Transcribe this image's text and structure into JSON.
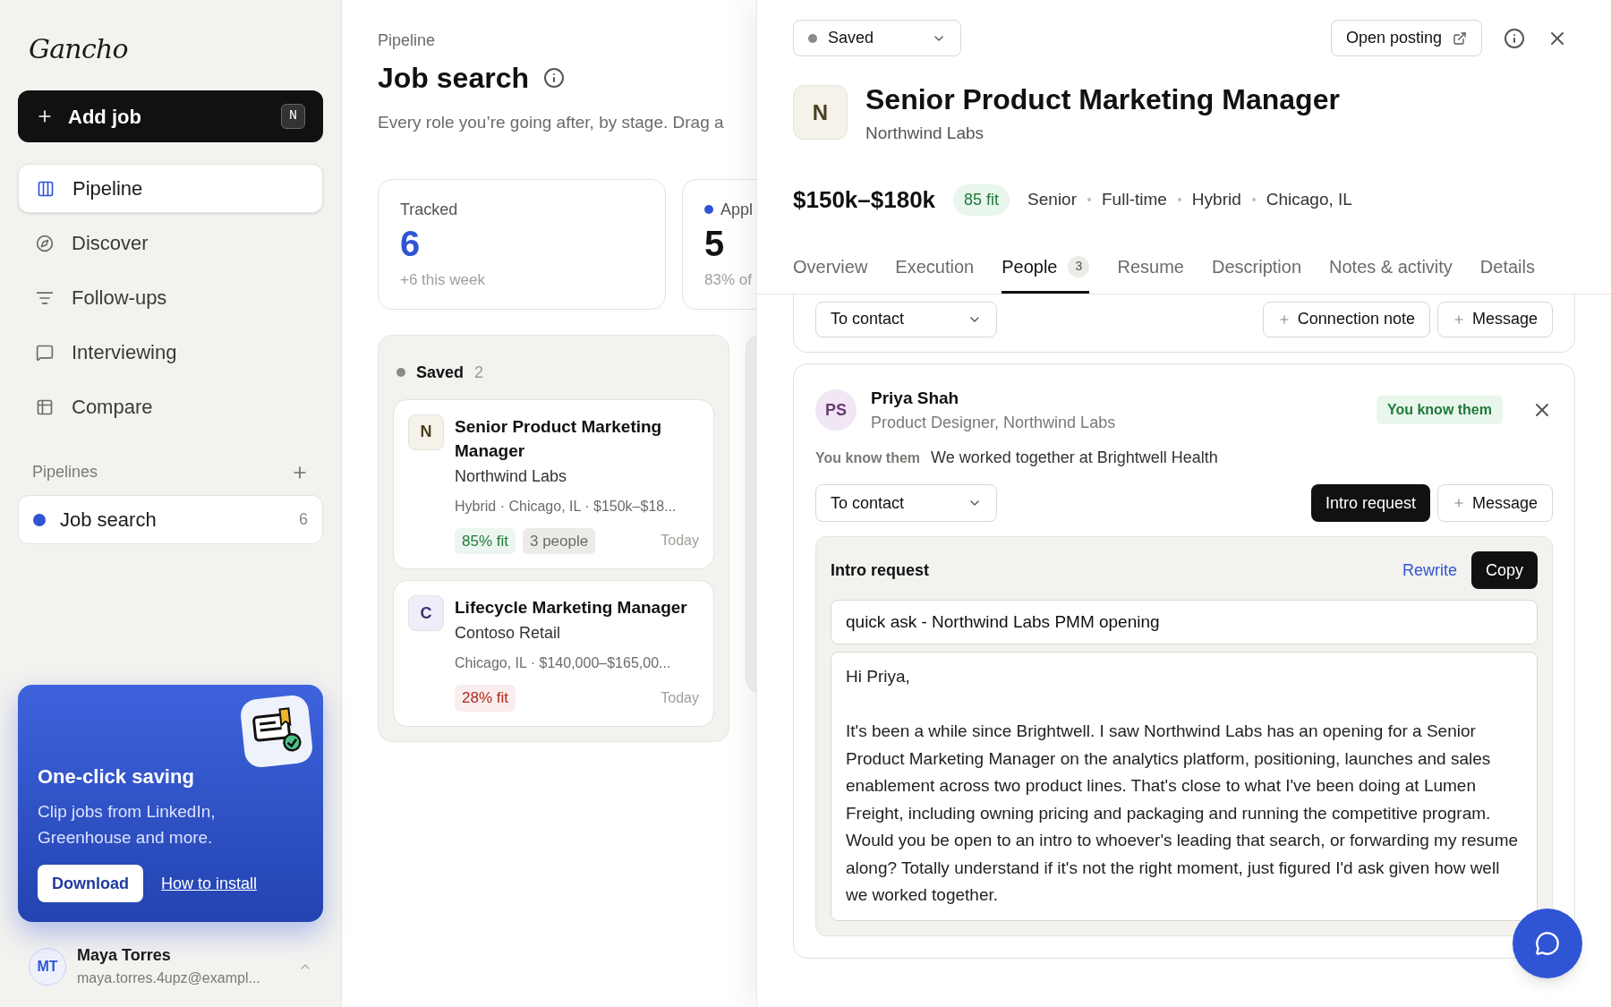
{
  "sidebar": {
    "logo": "Gancho",
    "add_job": {
      "label": "Add job",
      "shortcut": "N"
    },
    "nav": [
      {
        "label": "Pipeline",
        "selected": true
      },
      {
        "label": "Discover",
        "selected": false
      },
      {
        "label": "Follow-ups",
        "selected": false
      },
      {
        "label": "Interviewing",
        "selected": false
      },
      {
        "label": "Compare",
        "selected": false
      }
    ],
    "pipelines_label": "Pipelines",
    "pipelines": [
      {
        "label": "Job search",
        "count": "6",
        "color": "#2f55d4",
        "selected": true
      }
    ],
    "promo": {
      "title": "One-click saving",
      "text": "Clip jobs from LinkedIn, Greenhouse and more.",
      "button": "Download",
      "link": "How to install"
    },
    "user": {
      "initials": "MT",
      "name": "Maya Torres",
      "email": "maya.torres.4upz@exampl..."
    }
  },
  "main": {
    "breadcrumb": "Pipeline",
    "title": "Job search",
    "description": "Every role you’re going after, by stage. Drag a",
    "stats": [
      {
        "label": "Tracked",
        "value": "6",
        "note": "+6 this week",
        "highlight": true
      },
      {
        "label": "Appl",
        "value": "5",
        "note": "83% of",
        "highlight": false,
        "color": "#2f55d4"
      }
    ],
    "columns": [
      {
        "name": "Saved",
        "count": "2",
        "color": "#8a8a86",
        "cards": [
          {
            "initial": "N",
            "title": "Senior Product Marketing Manager",
            "company": "Northwind Labs",
            "meta": "Hybrid · Chicago, IL · $150k–$18...",
            "fit": "85% fit",
            "color": "#1f7a3a",
            "people": "3 people",
            "date": "Today"
          },
          {
            "initial": "C",
            "title": "Lifecycle Marketing Manager",
            "company": "Contoso Retail",
            "meta": "Chicago, IL · $140,000–$165,00...",
            "fit": "28% fit",
            "color": "#b3261e",
            "date": "Today"
          }
        ]
      }
    ]
  },
  "detail": {
    "status": "Saved",
    "open_posting": "Open posting",
    "initial": "N",
    "title": "Senior Product Marketing Manager",
    "company": "Northwind Labs",
    "salary": "$150k–$180k",
    "fit": "85 fit",
    "tags": [
      "Senior",
      "Full-time",
      "Hybrid",
      "Chicago, IL"
    ],
    "tabs": [
      {
        "label": "Overview",
        "selected": false
      },
      {
        "label": "Execution",
        "selected": false
      },
      {
        "label": "People",
        "count": "3",
        "selected": true
      },
      {
        "label": "Resume",
        "selected": false
      },
      {
        "label": "Description",
        "selected": false
      },
      {
        "label": "Notes & activity",
        "selected": false
      },
      {
        "label": "Details",
        "selected": false
      }
    ],
    "prev_card": {
      "status": "To contact",
      "actions": [
        "Connection note",
        "Message"
      ]
    },
    "contact": {
      "initials": "PS",
      "name": "Priya Shah",
      "role": "Product Designer, Northwind Labs",
      "badge": "You know them",
      "relation_label": "You know them",
      "relation": "We worked together at Brightwell Health",
      "status": "To contact",
      "primary_action": "Intro request",
      "secondary_action": "Message",
      "draft": {
        "title": "Intro request",
        "rewrite": "Rewrite",
        "copy": "Copy",
        "subject": "quick ask - Northwind Labs PMM opening",
        "body": "Hi Priya,\n\nIt's been a while since Brightwell. I saw Northwind Labs has an opening for a Senior Product Marketing Manager on the analytics platform, positioning, launches and sales enablement across two product lines. That's close to what I've been doing at Lumen Freight, including owning pricing and packaging and running the competitive program. Would you be open to an intro to whoever's leading that search, or forwarding my resume along? Totally understand if it's not the right moment, just figured I'd ask given how well we worked together."
      }
    }
  }
}
